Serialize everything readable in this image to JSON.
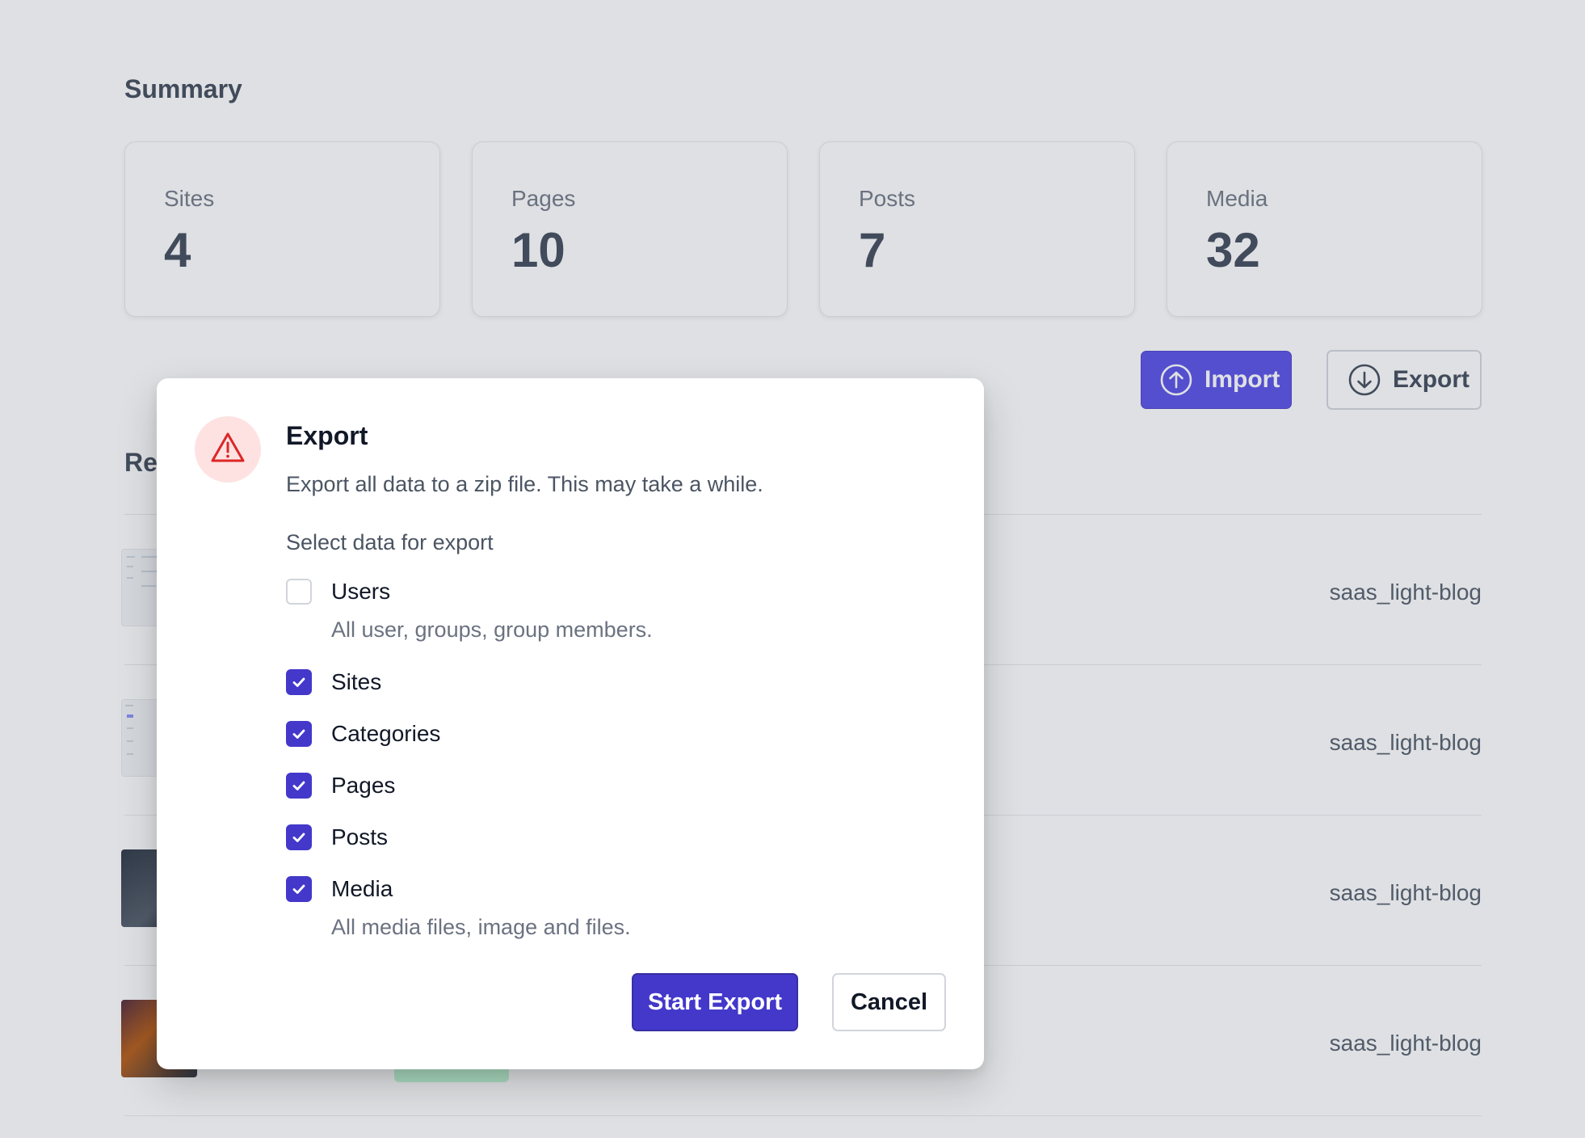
{
  "summary": {
    "title": "Summary",
    "stats": [
      {
        "label": "Sites",
        "value": "4"
      },
      {
        "label": "Pages",
        "value": "10"
      },
      {
        "label": "Posts",
        "value": "7"
      },
      {
        "label": "Media",
        "value": "32"
      }
    ]
  },
  "actions": {
    "import_label": "Import",
    "export_label": "Export"
  },
  "recent": {
    "title_partial": "Re",
    "rows": [
      {
        "site": "saas_light-blog"
      },
      {
        "site": "saas_light-blog"
      },
      {
        "site": "saas_light-blog"
      },
      {
        "site": "saas_light-blog"
      }
    ]
  },
  "modal": {
    "title": "Export",
    "description": "Export all data to a zip file. This may take a while.",
    "select_label": "Select data for export",
    "options": [
      {
        "label": "Users",
        "checked": false,
        "description": "All user, groups, group members."
      },
      {
        "label": "Sites",
        "checked": true
      },
      {
        "label": "Categories",
        "checked": true
      },
      {
        "label": "Pages",
        "checked": true
      },
      {
        "label": "Posts",
        "checked": true
      },
      {
        "label": "Media",
        "checked": true,
        "description": "All media files, image and files."
      }
    ],
    "start_label": "Start Export",
    "cancel_label": "Cancel"
  },
  "colors": {
    "primary": "#4338ca",
    "warning_bg": "#fee2e2",
    "warning_icon": "#dc2626"
  }
}
